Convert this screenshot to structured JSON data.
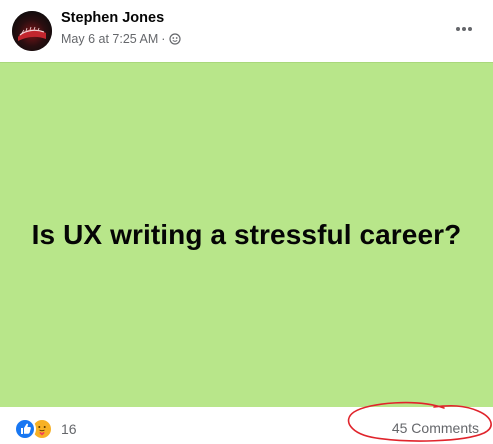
{
  "post": {
    "author": "Stephen Jones",
    "timestamp": "May 6 at 7:25 AM",
    "separator": "·",
    "audience_icon": "globe-icon",
    "more_icon": "more-options-icon",
    "banner_text": "Is UX writing a stressful career?",
    "banner_color": "#b8e68a",
    "reactions": {
      "icons": [
        "like-icon",
        "care-icon"
      ],
      "count": "16"
    },
    "comments_label": "45 Comments"
  },
  "annotation": {
    "color": "#e0242c"
  }
}
